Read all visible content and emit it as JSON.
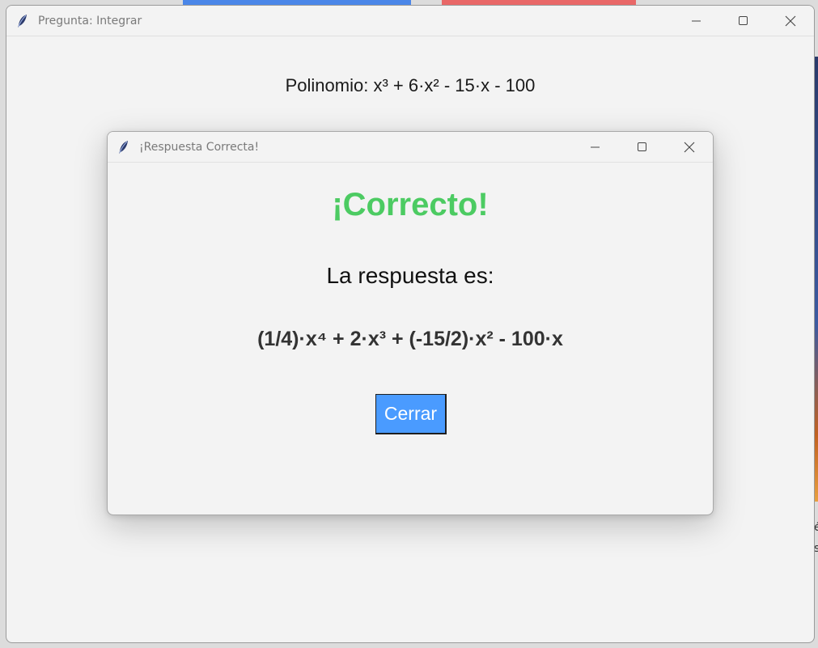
{
  "main_window": {
    "title": "Pregunta: Integrar",
    "polynomial_text": "Polinomio: x³  + 6·x²  - 15·x  - 100"
  },
  "dialog": {
    "title": "¡Respuesta Correcta!",
    "heading": "¡Correcto!",
    "answer_label": "La respuesta es:",
    "answer_value": "(1/4)·x⁴  + 2·x³ + (-15/2)·x²  - 100·x",
    "close_label": "Cerrar"
  },
  "background": {
    "right_glyph_1": "é",
    "right_glyph_2": "s"
  },
  "colors": {
    "heading": "#4ccb62",
    "button": "#4a9bff",
    "window_bg": "#f3f3f3"
  },
  "icons": [
    "feather-icon",
    "minimize-icon",
    "maximize-icon",
    "close-icon"
  ]
}
